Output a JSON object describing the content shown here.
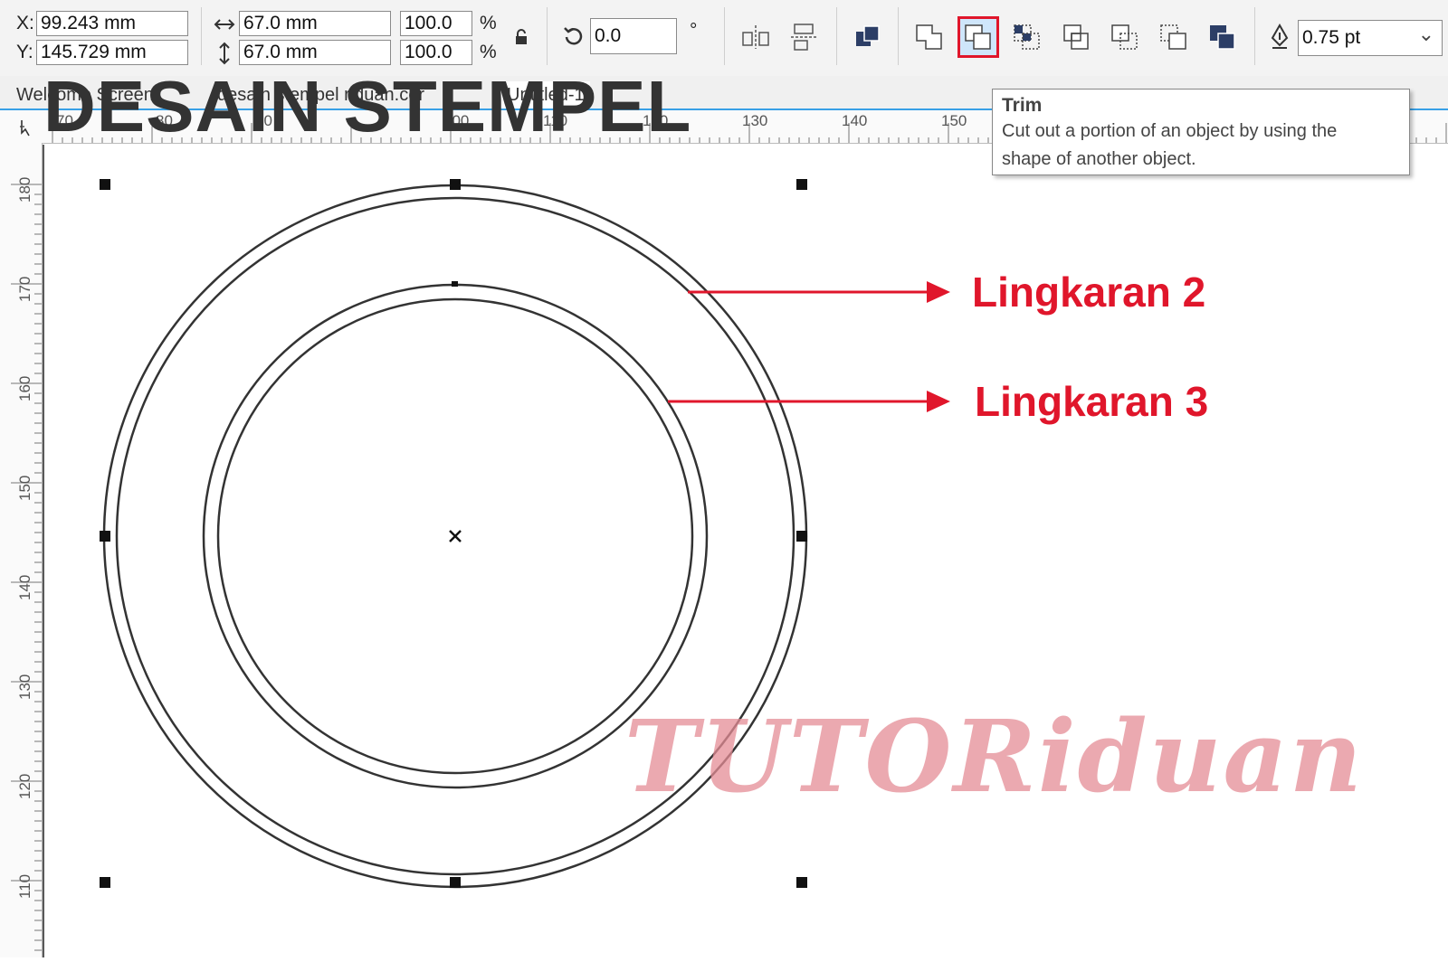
{
  "propbar": {
    "x_label": "X:",
    "y_label": "Y:",
    "x_value": "99.243 mm",
    "y_value": "145.729 mm",
    "width_value": "67.0 mm",
    "height_value": "67.0 mm",
    "scale_w": "100.0",
    "scale_h": "100.0",
    "pct": "%",
    "rotation_value": "0.0",
    "degree": "°",
    "outline_width": "0.75 pt",
    "outline_chevron": "⌄"
  },
  "tabs": [
    {
      "label": "Welcome Screen"
    },
    {
      "label": "desain stempel riduan.cdr"
    },
    {
      "label": "Untitled-1"
    }
  ],
  "ruler": {
    "h_ticks": [
      "70",
      "80",
      "90",
      "100",
      "110",
      "120",
      "130",
      "140",
      "150"
    ],
    "v_ticks": [
      "180",
      "170",
      "160",
      "150",
      "140",
      "130",
      "120",
      "110"
    ]
  },
  "overlay_title": "DESAIN STEMPEL",
  "tooltip": {
    "title": "Trim",
    "description_line1": "Cut out a portion of an object by using the",
    "description_line2": "shape of another object."
  },
  "annotations": {
    "label_1": "Lingkaran 2",
    "label_2": "Lingkaran 3"
  },
  "watermark": "TUTORiduan",
  "colors": {
    "accent_red": "#e0162b",
    "tab_underline": "#38a0e6",
    "watermark": "#e48c96"
  },
  "icons": {
    "pick_tool": "pick-tool-icon",
    "lock": "lock-ratio-icon",
    "rotate": "rotate-icon",
    "outline": "outline-pen-icon"
  }
}
